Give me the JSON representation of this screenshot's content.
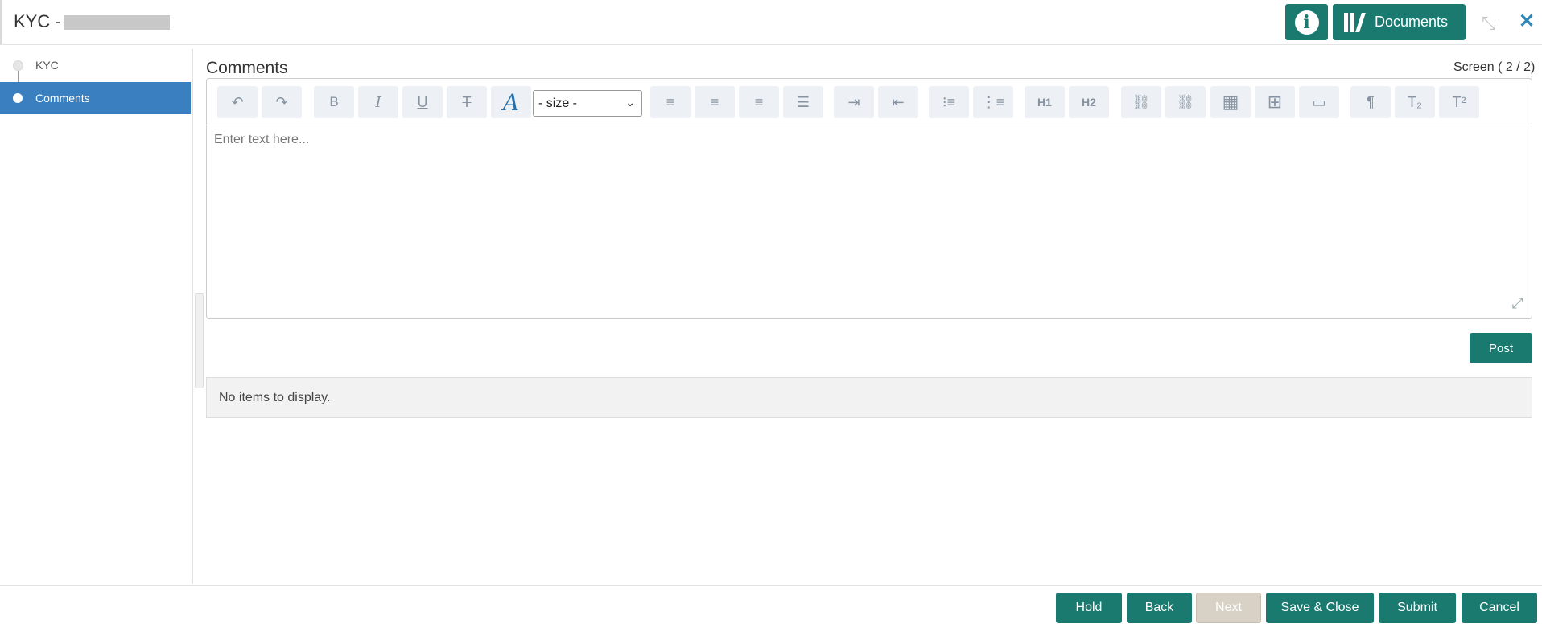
{
  "header": {
    "title": "KYC -",
    "documents_label": "Documents",
    "info_icon": "i"
  },
  "sidebar": {
    "items": [
      {
        "label": "KYC",
        "active": false
      },
      {
        "label": "Comments",
        "active": true
      }
    ]
  },
  "main": {
    "section_title": "Comments",
    "screen_info": "Screen ( 2 / 2)",
    "editor": {
      "size_value": "- size -",
      "placeholder": "Enter text here...",
      "h1_label": "H1",
      "h2_label": "H2"
    },
    "post_label": "Post",
    "empty_message": "No items to display."
  },
  "footer": {
    "hold": "Hold",
    "back": "Back",
    "next": "Next",
    "save_close": "Save & Close",
    "submit": "Submit",
    "cancel": "Cancel"
  },
  "colors": {
    "primary": "#1a7a6f",
    "active_nav": "#3a7fbf",
    "close_icon": "#2f86b7"
  }
}
